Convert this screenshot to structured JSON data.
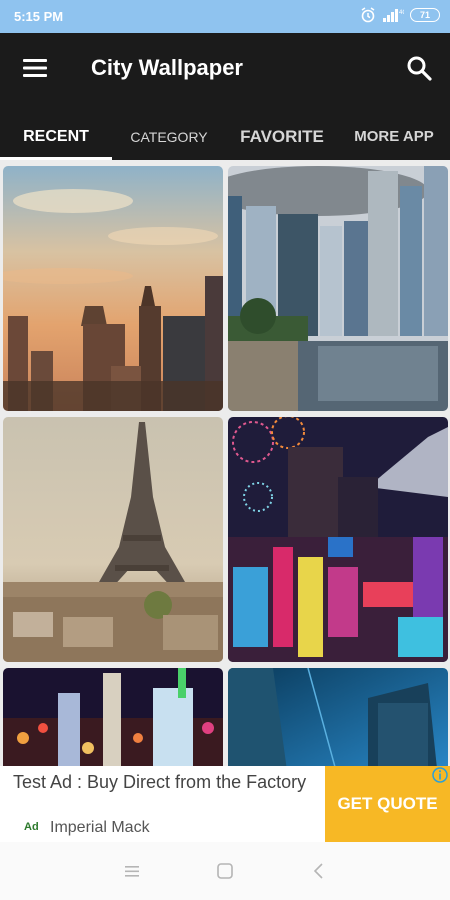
{
  "status_bar": {
    "time": "5:15 PM",
    "battery": "71"
  },
  "app_bar": {
    "title": "City Wallpaper",
    "menu_icon": "hamburger-menu-icon",
    "search_icon": "search-icon"
  },
  "tabs": [
    {
      "label": "RECENT",
      "active": true
    },
    {
      "label": "CATEGORY",
      "active": false
    },
    {
      "label": "FAVORITE",
      "active": false
    },
    {
      "label": "MORE APP",
      "active": false
    }
  ],
  "wallpapers": [
    {
      "subject": "sunset-skyline"
    },
    {
      "subject": "skyscrapers-waterfront"
    },
    {
      "subject": "eiffel-tower-paris"
    },
    {
      "subject": "neon-city-fireworks"
    },
    {
      "subject": "night-city-lights"
    },
    {
      "subject": "blue-glass-towers"
    }
  ],
  "ad": {
    "title": "Test Ad : Buy Direct from the Factory",
    "label": "Ad",
    "advertiser": "Imperial Mack",
    "cta": "GET QUOTE",
    "info_icon": "info-icon"
  },
  "nav_bar": {
    "icons": [
      "recent-apps-icon",
      "home-icon",
      "back-icon"
    ]
  },
  "colors": {
    "status_bar": "#8fc3ef",
    "app_bar": "#1b1b1b",
    "cta": "#f7b825"
  }
}
